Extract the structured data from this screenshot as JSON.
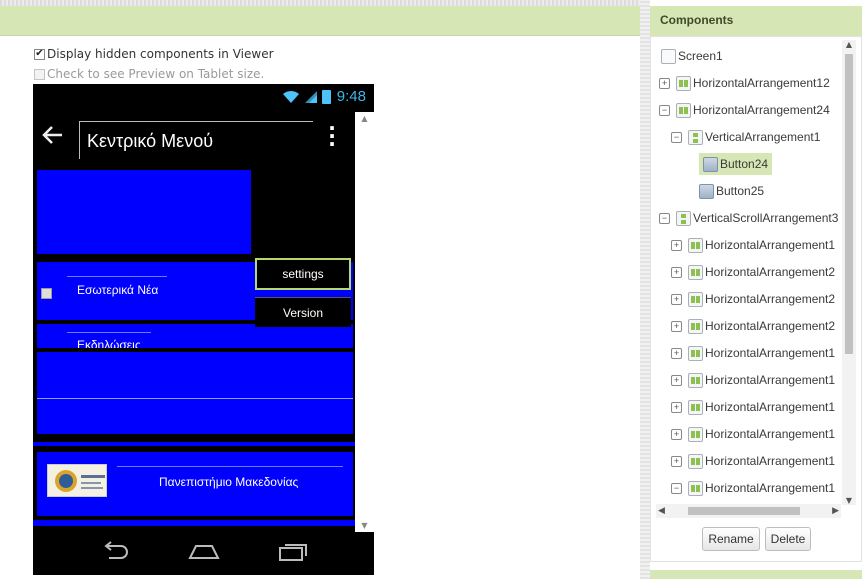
{
  "viewer": {
    "display_hidden_label": "Display hidden components in Viewer",
    "display_hidden_checked": true,
    "tablet_preview_label": "Check to see Preview on Tablet size.",
    "tablet_preview_checked": false
  },
  "phone": {
    "status_time": "9:48",
    "title": "Κεντρικό Μενού",
    "settings_label": "settings",
    "version_label": "Version",
    "news_label": "Εσωτερικά Νέα",
    "events_label": "Εκδηλώσεις",
    "university_label": "Πανεπιστήμιο Μακεδονίας",
    "icons": {
      "back": "back-arrow-icon",
      "overflow": "overflow-menu-icon",
      "wifi": "wifi-icon",
      "signal": "signal-icon",
      "battery": "battery-icon",
      "nav_back": "nav-back-icon",
      "nav_home": "nav-home-icon",
      "nav_recents": "nav-recents-icon"
    },
    "colors": {
      "arrangement_blue": "#0000ff",
      "settings_border": "#b5d96a",
      "time": "#3db7e8"
    }
  },
  "components": {
    "title": "Components",
    "tree": [
      {
        "label": "Screen1",
        "toggle": "",
        "icon": "screen"
      },
      {
        "label": "HorizontalArrangement12",
        "toggle": "+",
        "icon": "ha"
      },
      {
        "label": "HorizontalArrangement24",
        "toggle": "−",
        "icon": "ha"
      },
      {
        "label": "VerticalArrangement1",
        "toggle": "−",
        "icon": "va"
      },
      {
        "label": "Button24",
        "toggle": "",
        "icon": "btn",
        "selected": true
      },
      {
        "label": "Button25",
        "toggle": "",
        "icon": "btn"
      },
      {
        "label": "VerticalScrollArrangement3",
        "toggle": "−",
        "icon": "va"
      },
      {
        "label": "HorizontalArrangement1",
        "toggle": "+",
        "icon": "ha"
      },
      {
        "label": "HorizontalArrangement2",
        "toggle": "+",
        "icon": "ha"
      },
      {
        "label": "HorizontalArrangement2",
        "toggle": "+",
        "icon": "ha"
      },
      {
        "label": "HorizontalArrangement2",
        "toggle": "+",
        "icon": "ha"
      },
      {
        "label": "HorizontalArrangement1",
        "toggle": "+",
        "icon": "ha"
      },
      {
        "label": "HorizontalArrangement1",
        "toggle": "+",
        "icon": "ha"
      },
      {
        "label": "HorizontalArrangement1",
        "toggle": "+",
        "icon": "ha"
      },
      {
        "label": "HorizontalArrangement1",
        "toggle": "+",
        "icon": "ha"
      },
      {
        "label": "HorizontalArrangement1",
        "toggle": "+",
        "icon": "ha"
      },
      {
        "label": "HorizontalArrangement1",
        "toggle": "−",
        "icon": "ha"
      }
    ],
    "rename_label": "Rename",
    "delete_label": "Delete",
    "selected_color": "#d6e6b4"
  }
}
